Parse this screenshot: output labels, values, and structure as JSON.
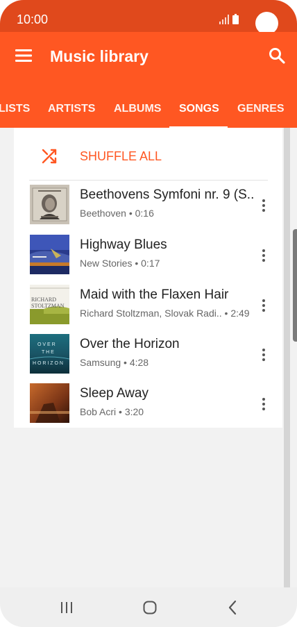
{
  "status_bar": {
    "time": "10:00"
  },
  "app_bar": {
    "title": "Music library",
    "icons": {
      "menu": "hamburger-menu-icon",
      "search": "search-icon"
    }
  },
  "tabs": [
    {
      "label": "LISTS",
      "selected": false
    },
    {
      "label": "ARTISTS",
      "selected": false
    },
    {
      "label": "ALBUMS",
      "selected": false
    },
    {
      "label": "SONGS",
      "selected": true
    },
    {
      "label": "GENRES",
      "selected": false
    }
  ],
  "shuffle": {
    "label": "SHUFFLE ALL",
    "icon": "shuffle-icon"
  },
  "songs": [
    {
      "title": "Beethovens Symfoni nr. 9 (S..",
      "subtitle": "Beethoven • 0:16"
    },
    {
      "title": "Highway Blues",
      "subtitle": "New Stories • 0:17"
    },
    {
      "title": "Maid with the Flaxen Hair",
      "subtitle": "Richard Stoltzman, Slovak Radi..  • 2:49"
    },
    {
      "title": "Over the Horizon",
      "subtitle": "Samsung • 4:28"
    },
    {
      "title": "Sleep Away",
      "subtitle": "Bob Acri • 3:20"
    }
  ],
  "album_art_text": {
    "maid": {
      "line1": "RICHARD",
      "line2": "STOLTZMAN"
    },
    "horizon": {
      "line1": "O V E R",
      "line2": "T H E",
      "line3": "H O R I Z O N"
    }
  },
  "colors": {
    "accent": "#ff5722",
    "status_bar": "#e0491c",
    "background": "#f2f2f2"
  },
  "nav_bar": {
    "icons": [
      "recent-apps-icon",
      "home-icon",
      "back-icon"
    ]
  }
}
